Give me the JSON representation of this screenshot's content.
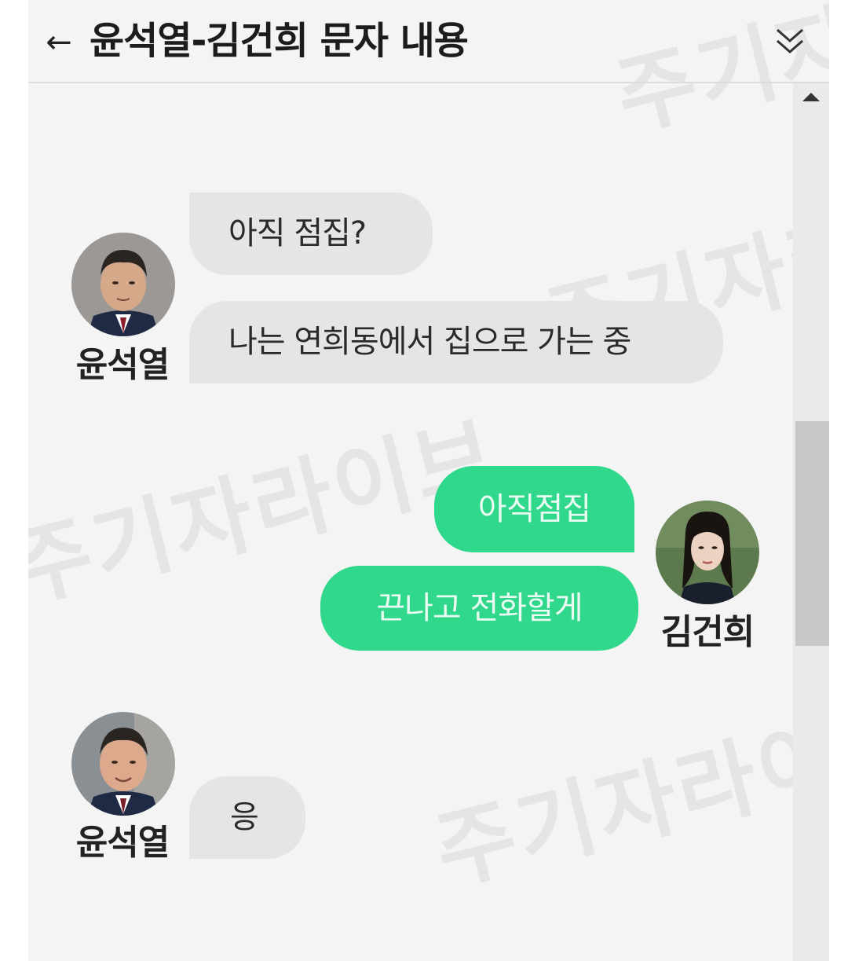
{
  "header": {
    "back_icon": "←",
    "title": "윤석열-김건희 문자 내용",
    "collapse_icon": "double-chevron-down-icon"
  },
  "colors": {
    "panel_bg": "#f3f4f3",
    "incoming_bubble": "#e4e6e6",
    "outgoing_bubble": "#2fd88a",
    "outgoing_text": "#e9fbf2",
    "scroll_thumb": "#c7c7c7"
  },
  "messages": [
    {
      "sender": "윤석열",
      "side": "left",
      "text": "아직 점집?"
    },
    {
      "sender": "윤석열",
      "side": "left",
      "text": "나는 연희동에서 집으로 가는 중"
    },
    {
      "sender": "김건희",
      "side": "right",
      "text": "아직점집"
    },
    {
      "sender": "김건희",
      "side": "right",
      "text": "끈나고 전화할게"
    },
    {
      "sender": "윤석열",
      "side": "left",
      "text": "응"
    }
  ],
  "senders": {
    "yoon": {
      "name": "윤석열"
    },
    "kim": {
      "name": "김건희"
    }
  },
  "watermark": "주기자라이브"
}
